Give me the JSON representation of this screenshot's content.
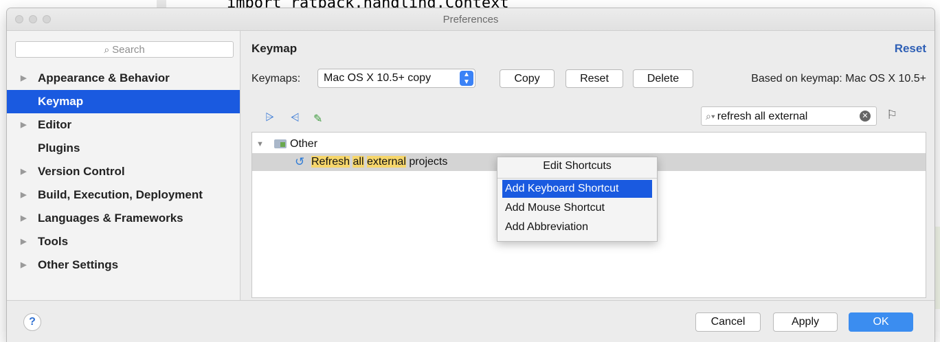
{
  "background": {
    "code_line": "import ratpack.handling.Context"
  },
  "window": {
    "title": "Preferences"
  },
  "sidebar": {
    "search_placeholder": "Search",
    "items": [
      {
        "label": "Appearance & Behavior",
        "expandable": true
      },
      {
        "label": "Keymap",
        "expandable": false,
        "selected": true
      },
      {
        "label": "Editor",
        "expandable": true
      },
      {
        "label": "Plugins",
        "expandable": false
      },
      {
        "label": "Version Control",
        "expandable": true
      },
      {
        "label": "Build, Execution, Deployment",
        "expandable": true
      },
      {
        "label": "Languages & Frameworks",
        "expandable": true
      },
      {
        "label": "Tools",
        "expandable": true
      },
      {
        "label": "Other Settings",
        "expandable": true
      }
    ]
  },
  "keymap": {
    "title": "Keymap",
    "reset_link": "Reset",
    "keymaps_label": "Keymaps:",
    "selected_keymap": "Mac OS X 10.5+ copy",
    "copy_button": "Copy",
    "reset_button": "Reset",
    "delete_button": "Delete",
    "based_on": "Based on keymap: Mac OS X 10.5+",
    "filter_value": "refresh all external"
  },
  "tree": {
    "group_label": "Other",
    "action": {
      "parts": [
        {
          "text": "Refresh",
          "highlight": true
        },
        {
          "text": " ",
          "highlight": false
        },
        {
          "text": "all",
          "highlight": true
        },
        {
          "text": " ",
          "highlight": false
        },
        {
          "text": "external",
          "highlight": true
        },
        {
          "text": " projects",
          "highlight": false
        }
      ]
    }
  },
  "popup": {
    "title": "Edit Shortcuts",
    "items": [
      {
        "label": "Add Keyboard Shortcut",
        "active": true
      },
      {
        "label": "Add Mouse Shortcut",
        "active": false
      },
      {
        "label": "Add Abbreviation",
        "active": false
      }
    ]
  },
  "footer": {
    "help": "?",
    "cancel": "Cancel",
    "apply": "Apply",
    "ok": "OK"
  },
  "colors": {
    "selection": "#1a5ae0",
    "link": "#2e5fb5",
    "highlight": "#f6d66b",
    "ok_button": "#3b8df0"
  }
}
